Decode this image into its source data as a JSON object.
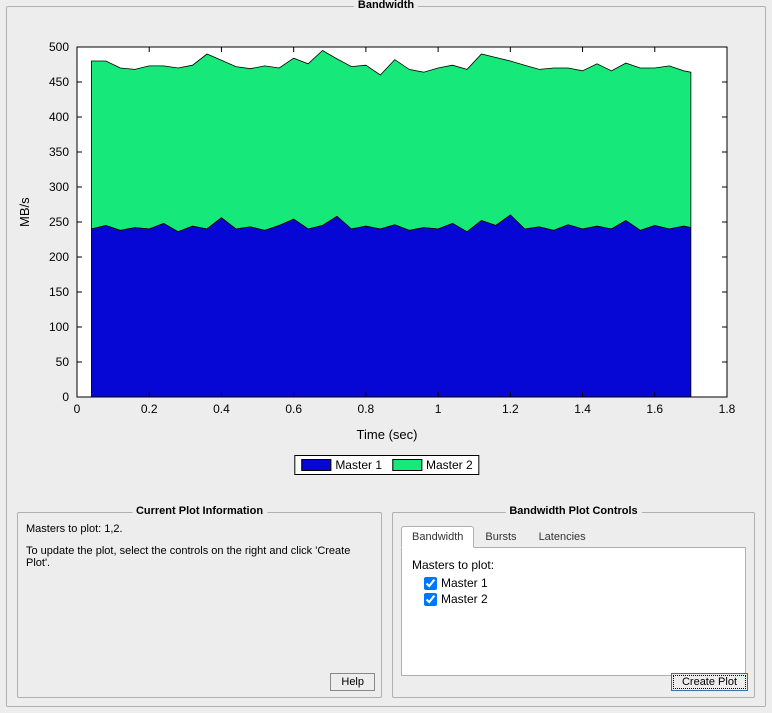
{
  "panel_title": "Bandwidth",
  "info_panel": {
    "title": "Current Plot Information",
    "line1": "Masters to plot: 1,2.",
    "line2": "To update the plot, select the controls on the right and click 'Create Plot'.",
    "help_label": "Help"
  },
  "controls_panel": {
    "title": "Bandwidth Plot Controls",
    "tabs": {
      "t0": "Bandwidth",
      "t1": "Bursts",
      "t2": "Latencies"
    },
    "masters_label": "Masters to plot:",
    "master1_label": "Master 1",
    "master2_label": "Master 2",
    "create_label": "Create Plot"
  },
  "chart": {
    "ylabel": "MB/s",
    "xlabel": "Time (sec)",
    "legend": {
      "s0": "Master 1",
      "s1": "Master 2"
    },
    "colors": {
      "s0": "#0707d5",
      "s1": "#17e87a"
    }
  },
  "chart_data": {
    "type": "area",
    "stacked": true,
    "xlabel": "Time (sec)",
    "ylabel": "MB/s",
    "xlim": [
      0,
      1.8
    ],
    "ylim": [
      0,
      500
    ],
    "xticks": [
      0,
      0.2,
      0.4,
      0.6,
      0.8,
      1.0,
      1.2,
      1.4,
      1.6,
      1.8
    ],
    "yticks": [
      0,
      50,
      100,
      150,
      200,
      250,
      300,
      350,
      400,
      450,
      500
    ],
    "x": [
      0.04,
      0.08,
      0.12,
      0.16,
      0.2,
      0.24,
      0.28,
      0.32,
      0.36,
      0.4,
      0.44,
      0.48,
      0.52,
      0.56,
      0.6,
      0.64,
      0.68,
      0.72,
      0.76,
      0.8,
      0.84,
      0.88,
      0.92,
      0.96,
      1.0,
      1.04,
      1.08,
      1.12,
      1.16,
      1.2,
      1.24,
      1.28,
      1.32,
      1.36,
      1.4,
      1.44,
      1.48,
      1.52,
      1.56,
      1.6,
      1.64,
      1.68,
      1.7
    ],
    "series": [
      {
        "name": "Master 1",
        "color": "#0707d5",
        "values": [
          240,
          245,
          238,
          242,
          240,
          248,
          236,
          244,
          240,
          256,
          240,
          243,
          238,
          245,
          254,
          240,
          245,
          258,
          240,
          244,
          240,
          246,
          238,
          242,
          240,
          248,
          236,
          252,
          245,
          260,
          240,
          243,
          238,
          246,
          240,
          244,
          240,
          252,
          238,
          245,
          240,
          244,
          242
        ]
      },
      {
        "name": "Master 2",
        "color": "#17e87a",
        "values": [
          240,
          235,
          232,
          226,
          233,
          225,
          234,
          230,
          250,
          225,
          232,
          226,
          235,
          225,
          230,
          236,
          250,
          225,
          232,
          230,
          220,
          236,
          230,
          222,
          230,
          226,
          232,
          238,
          240,
          220,
          234,
          225,
          232,
          224,
          226,
          232,
          226,
          225,
          232,
          225,
          233,
          222,
          222
        ]
      }
    ]
  }
}
